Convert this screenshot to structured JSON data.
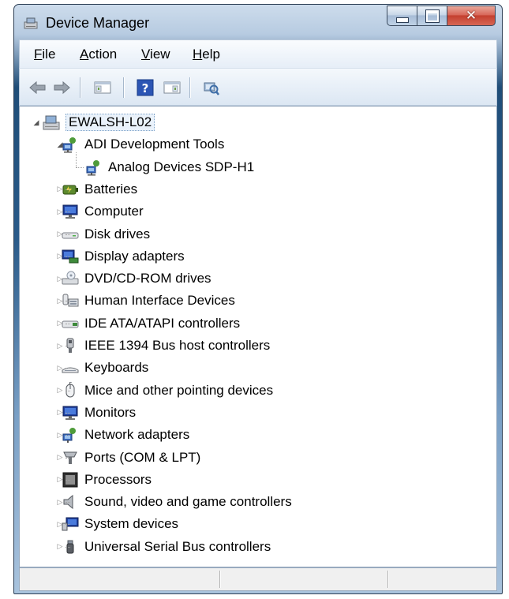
{
  "window": {
    "title": "Device Manager"
  },
  "menu": {
    "file": {
      "accel": "F",
      "rest": "ile"
    },
    "action": {
      "accel": "A",
      "rest": "ction"
    },
    "view": {
      "accel": "V",
      "rest": "iew"
    },
    "help": {
      "accel": "H",
      "rest": "elp"
    }
  },
  "toolbar": {
    "buttons": [
      "back-arrow-icon",
      "forward-arrow-icon",
      "show-hide-console-tree-icon",
      "help-icon",
      "action-pane-icon",
      "scan-hardware-icon"
    ]
  },
  "tree": {
    "root": {
      "label": "EWALSH-L02",
      "icon": "computer-icon",
      "expanded": true
    },
    "items": [
      {
        "label": "ADI Development Tools",
        "icon": "network-device-icon",
        "expanded": true
      },
      {
        "label": "Analog Devices SDP-H1",
        "icon": "network-device-icon",
        "child": true
      },
      {
        "label": "Batteries",
        "icon": "battery-icon"
      },
      {
        "label": "Computer",
        "icon": "monitor-icon"
      },
      {
        "label": "Disk drives",
        "icon": "disk-drive-icon"
      },
      {
        "label": "Display adapters",
        "icon": "display-adapter-icon"
      },
      {
        "label": "DVD/CD-ROM drives",
        "icon": "dvd-drive-icon"
      },
      {
        "label": "Human Interface Devices",
        "icon": "hid-icon"
      },
      {
        "label": "IDE ATA/ATAPI controllers",
        "icon": "ide-controller-icon"
      },
      {
        "label": "IEEE 1394 Bus host controllers",
        "icon": "ieee1394-icon"
      },
      {
        "label": "Keyboards",
        "icon": "keyboard-icon"
      },
      {
        "label": "Mice and other pointing devices",
        "icon": "mouse-icon"
      },
      {
        "label": "Monitors",
        "icon": "monitor-icon"
      },
      {
        "label": "Network adapters",
        "icon": "network-adapter-icon"
      },
      {
        "label": "Ports (COM & LPT)",
        "icon": "port-icon"
      },
      {
        "label": "Processors",
        "icon": "processor-icon"
      },
      {
        "label": "Sound, video and game controllers",
        "icon": "speaker-icon"
      },
      {
        "label": "System devices",
        "icon": "system-device-icon"
      },
      {
        "label": "Universal Serial Bus controllers",
        "icon": "usb-icon"
      }
    ]
  },
  "colors": {
    "title_gradient_top": "#cddcec",
    "title_gradient_dark": "#1f4d78",
    "close_button": "#c4402f",
    "selection_border": "#7fa4c9"
  }
}
